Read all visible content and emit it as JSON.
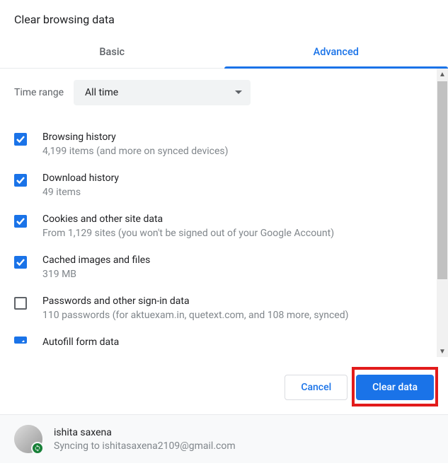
{
  "dialog": {
    "title": "Clear browsing data"
  },
  "tabs": {
    "basic": "Basic",
    "advanced": "Advanced"
  },
  "timeRange": {
    "label": "Time range",
    "selected": "All time"
  },
  "items": [
    {
      "title": "Browsing history",
      "sub": "4,199 items (and more on synced devices)",
      "checked": true
    },
    {
      "title": "Download history",
      "sub": "49 items",
      "checked": true
    },
    {
      "title": "Cookies and other site data",
      "sub": "From 1,129 sites (you won't be signed out of your Google Account)",
      "checked": true
    },
    {
      "title": "Cached images and files",
      "sub": "319 MB",
      "checked": true
    },
    {
      "title": "Passwords and other sign-in data",
      "sub": "110 passwords (for aktuexam.in, quetext.com, and 108 more, synced)",
      "checked": false
    },
    {
      "title": "Autofill form data",
      "sub": "",
      "checked": true
    }
  ],
  "buttons": {
    "cancel": "Cancel",
    "clear": "Clear data"
  },
  "profile": {
    "name": "ishita saxena",
    "sync": "Syncing to ishitasaxena2109@gmail.com"
  }
}
